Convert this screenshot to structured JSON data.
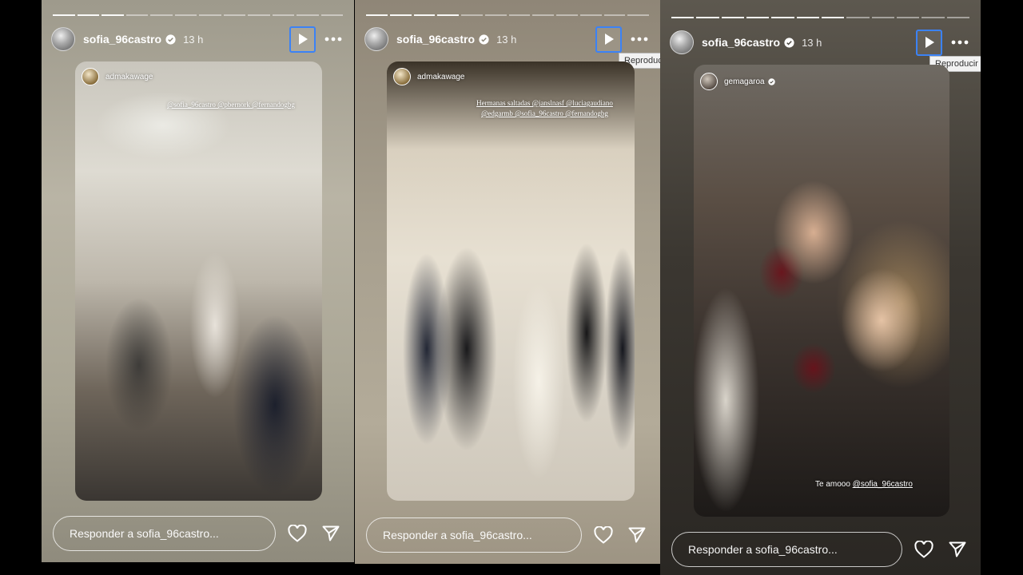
{
  "colors": {
    "accent_focus": "#3b82f6",
    "text": "#ffffff",
    "background": "#000000"
  },
  "icons": [
    "verified-badge-icon",
    "play-icon",
    "more-options-icon",
    "heart-icon",
    "send-icon"
  ],
  "stories": [
    {
      "username": "sofia_96castro",
      "time": "13 h",
      "progress": {
        "segments": 12,
        "completed": 3
      },
      "mention_user": "admakawage",
      "overlay_text": "@sofia_96castro @pbernork @fernandogbg",
      "reply_placeholder": "Responder a sofia_96castro..."
    },
    {
      "username": "sofia_96castro",
      "time": "13 h",
      "tooltip": "Reproducir",
      "progress": {
        "segments": 12,
        "completed": 4
      },
      "mention_user": "admakawage",
      "overlay_text": "Hermanas saltadas @janslnasf @luciagaudiano @edgarmb @sofia_96castro @fernandogbg",
      "reply_placeholder": "Responder a sofia_96castro..."
    },
    {
      "username": "sofia_96castro",
      "time": "13 h",
      "tooltip": "Reproducir",
      "progress": {
        "segments": 12,
        "completed": 7
      },
      "mention_user": "gemagaroa",
      "caption_text": "Te amooo",
      "caption_link": "@sofia_96castro",
      "reply_placeholder": "Responder a sofia_96castro..."
    }
  ]
}
